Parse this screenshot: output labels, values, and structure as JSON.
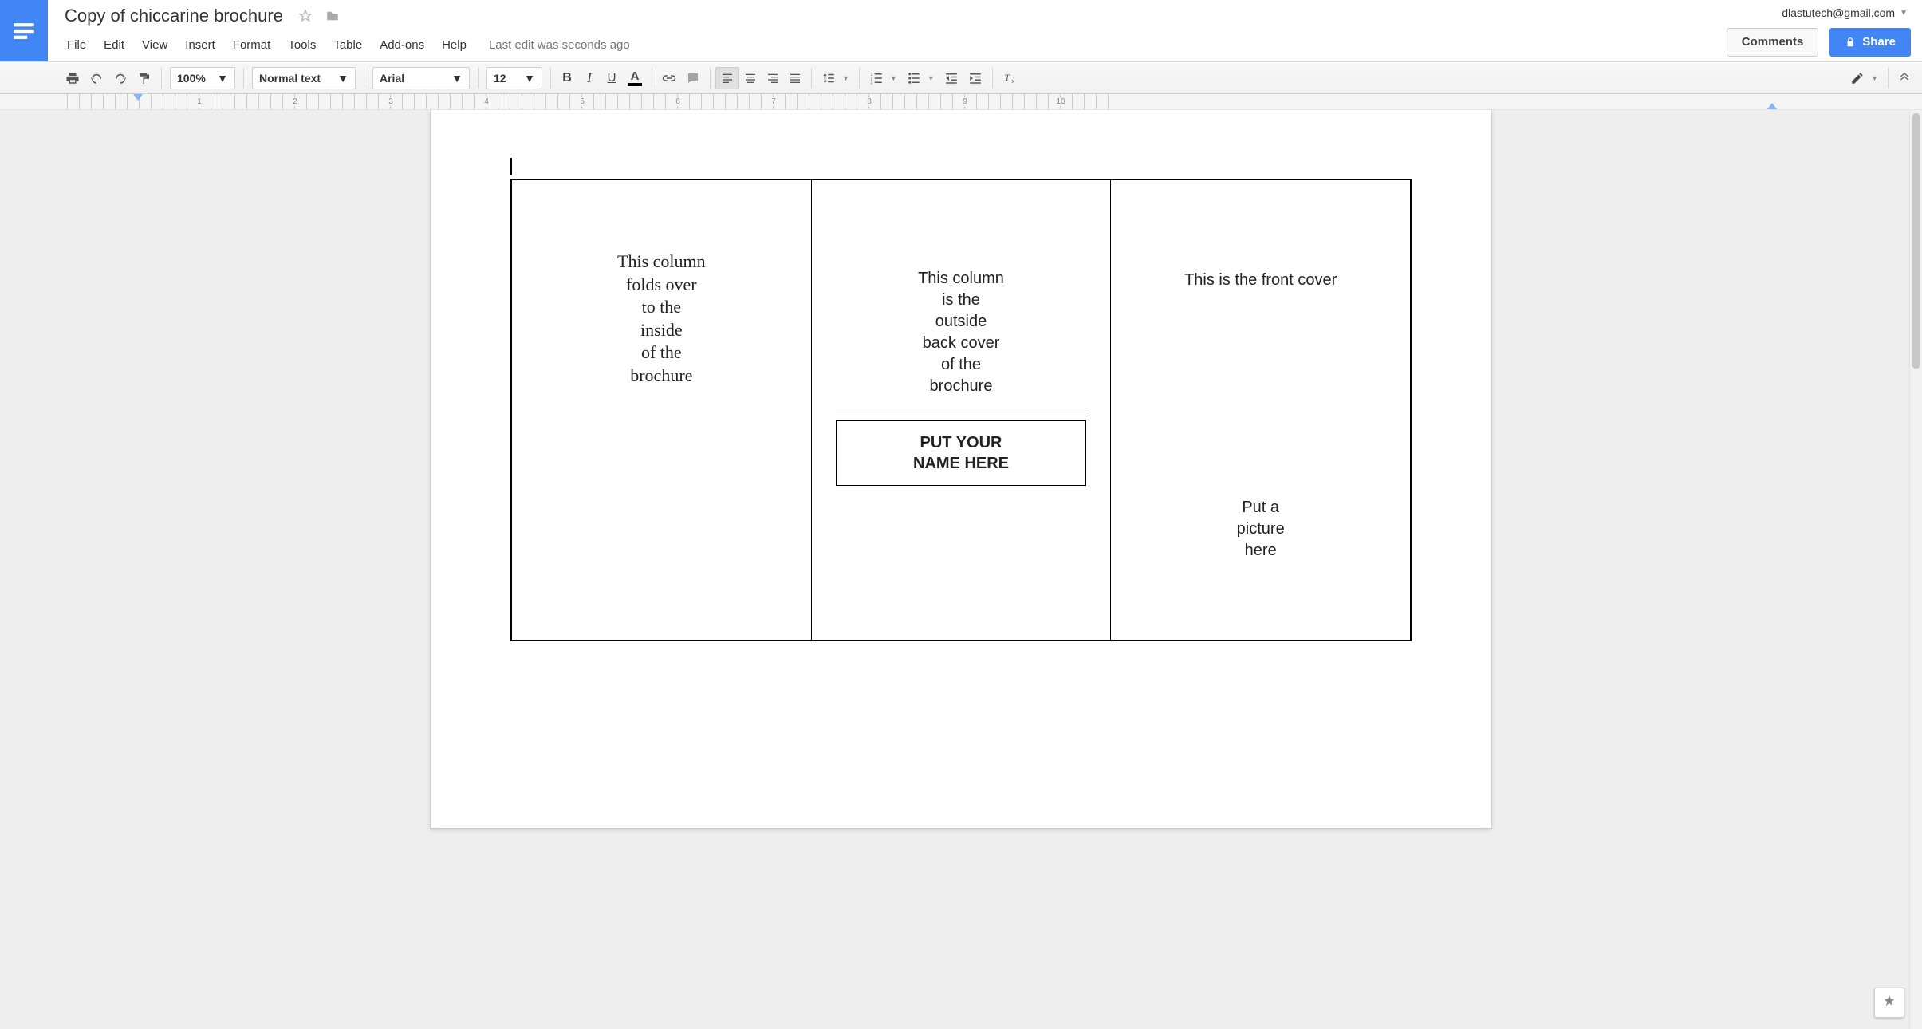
{
  "header": {
    "title": "Copy of chiccarine brochure",
    "account_email": "dlastutech@gmail.com",
    "comments_label": "Comments",
    "share_label": "Share"
  },
  "menu": {
    "items": [
      "File",
      "Edit",
      "View",
      "Insert",
      "Format",
      "Tools",
      "Table",
      "Add-ons",
      "Help"
    ],
    "last_edit": "Last edit was seconds ago"
  },
  "toolbar": {
    "zoom": "100%",
    "paragraph_style": "Normal text",
    "font": "Arial",
    "font_size": "12"
  },
  "ruler": {
    "marks": [
      "",
      "1",
      "2",
      "3",
      "4",
      "5",
      "6",
      "7",
      "8",
      "9",
      "10"
    ]
  },
  "document": {
    "col1_text": "This column\nfolds over\nto the\ninside\nof the\nbrochure",
    "col2_text": "This column\nis the\noutside\nback cover\nof the\nbrochure",
    "col2_name_box": "PUT YOUR\nNAME HERE",
    "col3_title": "This is the front cover",
    "col3_picture": "Put a\npicture\nhere"
  }
}
